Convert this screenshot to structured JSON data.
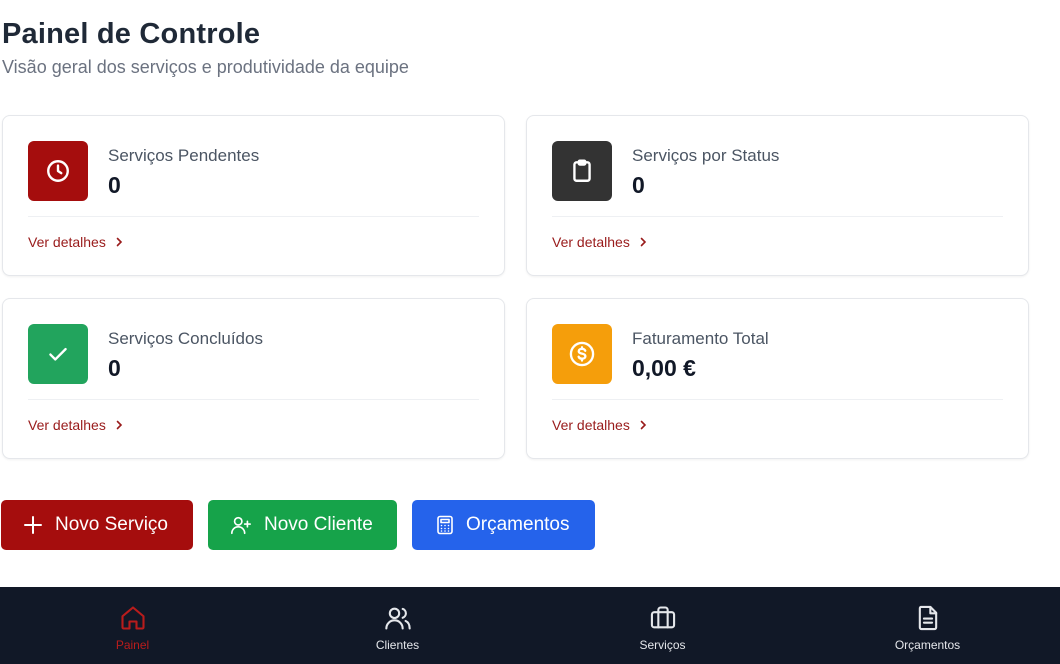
{
  "header": {
    "title": "Painel de Controle",
    "subtitle": "Visão geral dos serviços e produtividade da equipe"
  },
  "cards": [
    {
      "label": "Serviços Pendentes",
      "value": "0",
      "link": "Ver detalhes",
      "icon": "clock-icon",
      "color": "#a50d0d"
    },
    {
      "label": "Serviços por Status",
      "value": "0",
      "link": "Ver detalhes",
      "icon": "clipboard-icon",
      "color": "#333333"
    },
    {
      "label": "Serviços Concluídos",
      "value": "0",
      "link": "Ver detalhes",
      "icon": "check-icon",
      "color": "#22a45d"
    },
    {
      "label": "Faturamento Total",
      "value": "0,00 €",
      "link": "Ver detalhes",
      "icon": "dollar-icon",
      "color": "#f59e0b"
    }
  ],
  "actions": {
    "new_service": "Novo Serviço",
    "new_client": "Novo Cliente",
    "quotes": "Orçamentos"
  },
  "nav": {
    "items": [
      {
        "label": "Painel",
        "icon": "home-icon",
        "active": true
      },
      {
        "label": "Clientes",
        "icon": "users-icon",
        "active": false
      },
      {
        "label": "Serviços",
        "icon": "briefcase-icon",
        "active": false
      },
      {
        "label": "Orçamentos",
        "icon": "document-icon",
        "active": false
      }
    ],
    "active_color": "#b91c1c"
  }
}
